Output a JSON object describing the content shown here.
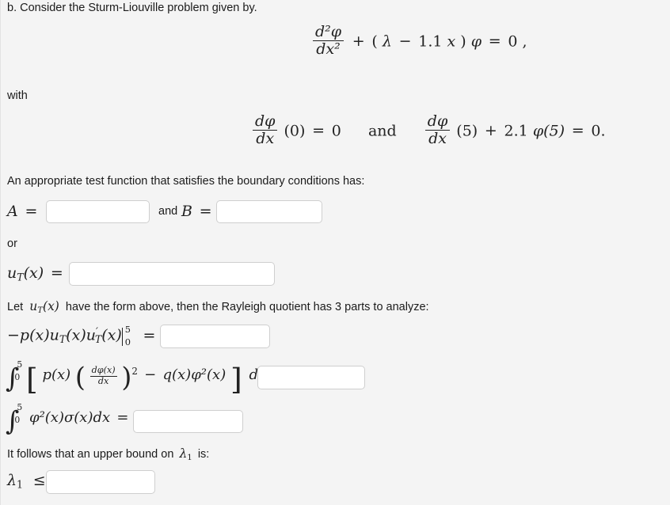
{
  "page": {
    "background_color": "#f4f4f4",
    "text_color": "#1b1b1b",
    "input_border_color": "#cfcfcf",
    "input_background_color": "#ffffff"
  },
  "prompt": {
    "part_label": "b.",
    "intro": "b. Consider the Sturm-Liouville problem given by.",
    "with_label": "with",
    "test_function_prompt": "An appropriate test function that satisfies the boundary conditions has:",
    "or_label": "or",
    "rayleigh_intro_before": "Let",
    "rayleigh_intro_after": "have the form above, then the Rayleigh quotient has 3 parts to analyze:",
    "upper_bound_before": "It follows that an upper bound on",
    "upper_bound_after": "is:",
    "and_label": "and"
  },
  "equations": {
    "ode": {
      "frac_num": "d²φ",
      "frac_den": "dx²",
      "rest": "+ (λ − 1.1x)φ = 0,",
      "plus": "+",
      "open_paren": "(",
      "lambda": "λ",
      "minus": "−",
      "coefficient": "1.1",
      "variable": "x",
      "close_paren": ")",
      "phi": "φ",
      "equals": "=",
      "zero": "0",
      "comma": ","
    },
    "bc_left": {
      "frac_num": "dφ",
      "frac_den": "dx",
      "arg": "(0)",
      "equals": "=",
      "value": "0"
    },
    "bc_conjunction": "and",
    "bc_right": {
      "frac_num": "dφ",
      "frac_den": "dx",
      "arg": "(5)",
      "plus": "+",
      "coefficient": "2.1",
      "phi_term": "φ(5)",
      "equals": "=",
      "value": "0."
    },
    "label_A": "A",
    "label_B": "B",
    "equals": "=",
    "u_T": {
      "u": "u",
      "sub": "T",
      "arg": "(x)",
      "equals": "="
    },
    "part1": {
      "expr": "−p(x)u",
      "sub1": "T",
      "arg1": "(x)u",
      "prime": "′",
      "sub2": "T",
      "arg2": "(x)",
      "eval_upper": "5",
      "eval_lower": "0",
      "equals": "="
    },
    "part2": {
      "int_upper": "5",
      "int_lower": "0",
      "p_of_x": "p(x)",
      "frac_num": "dφ(x)",
      "frac_den": "dx",
      "exponent": "2",
      "minus": "−",
      "q_term": "q(x)φ²(x)",
      "dx": "dx",
      "equals": "="
    },
    "part3": {
      "int_upper": "5",
      "int_lower": "0",
      "integrand": "φ²(x)σ(x)dx",
      "equals": "="
    },
    "lambda_1": {
      "lambda": "λ",
      "sub": "1",
      "leq": "≤"
    }
  },
  "inputs": {
    "A": {
      "name": "answer-A",
      "value": "",
      "placeholder": ""
    },
    "B": {
      "name": "answer-B",
      "value": "",
      "placeholder": ""
    },
    "u_T": {
      "name": "answer-uT",
      "value": "",
      "placeholder": ""
    },
    "part1": {
      "name": "answer-part1",
      "value": "",
      "placeholder": ""
    },
    "part2": {
      "name": "answer-part2",
      "value": "",
      "placeholder": ""
    },
    "part3": {
      "name": "answer-part3",
      "value": "",
      "placeholder": ""
    },
    "lambda_bound": {
      "name": "answer-lambda-bound",
      "value": "",
      "placeholder": ""
    }
  }
}
